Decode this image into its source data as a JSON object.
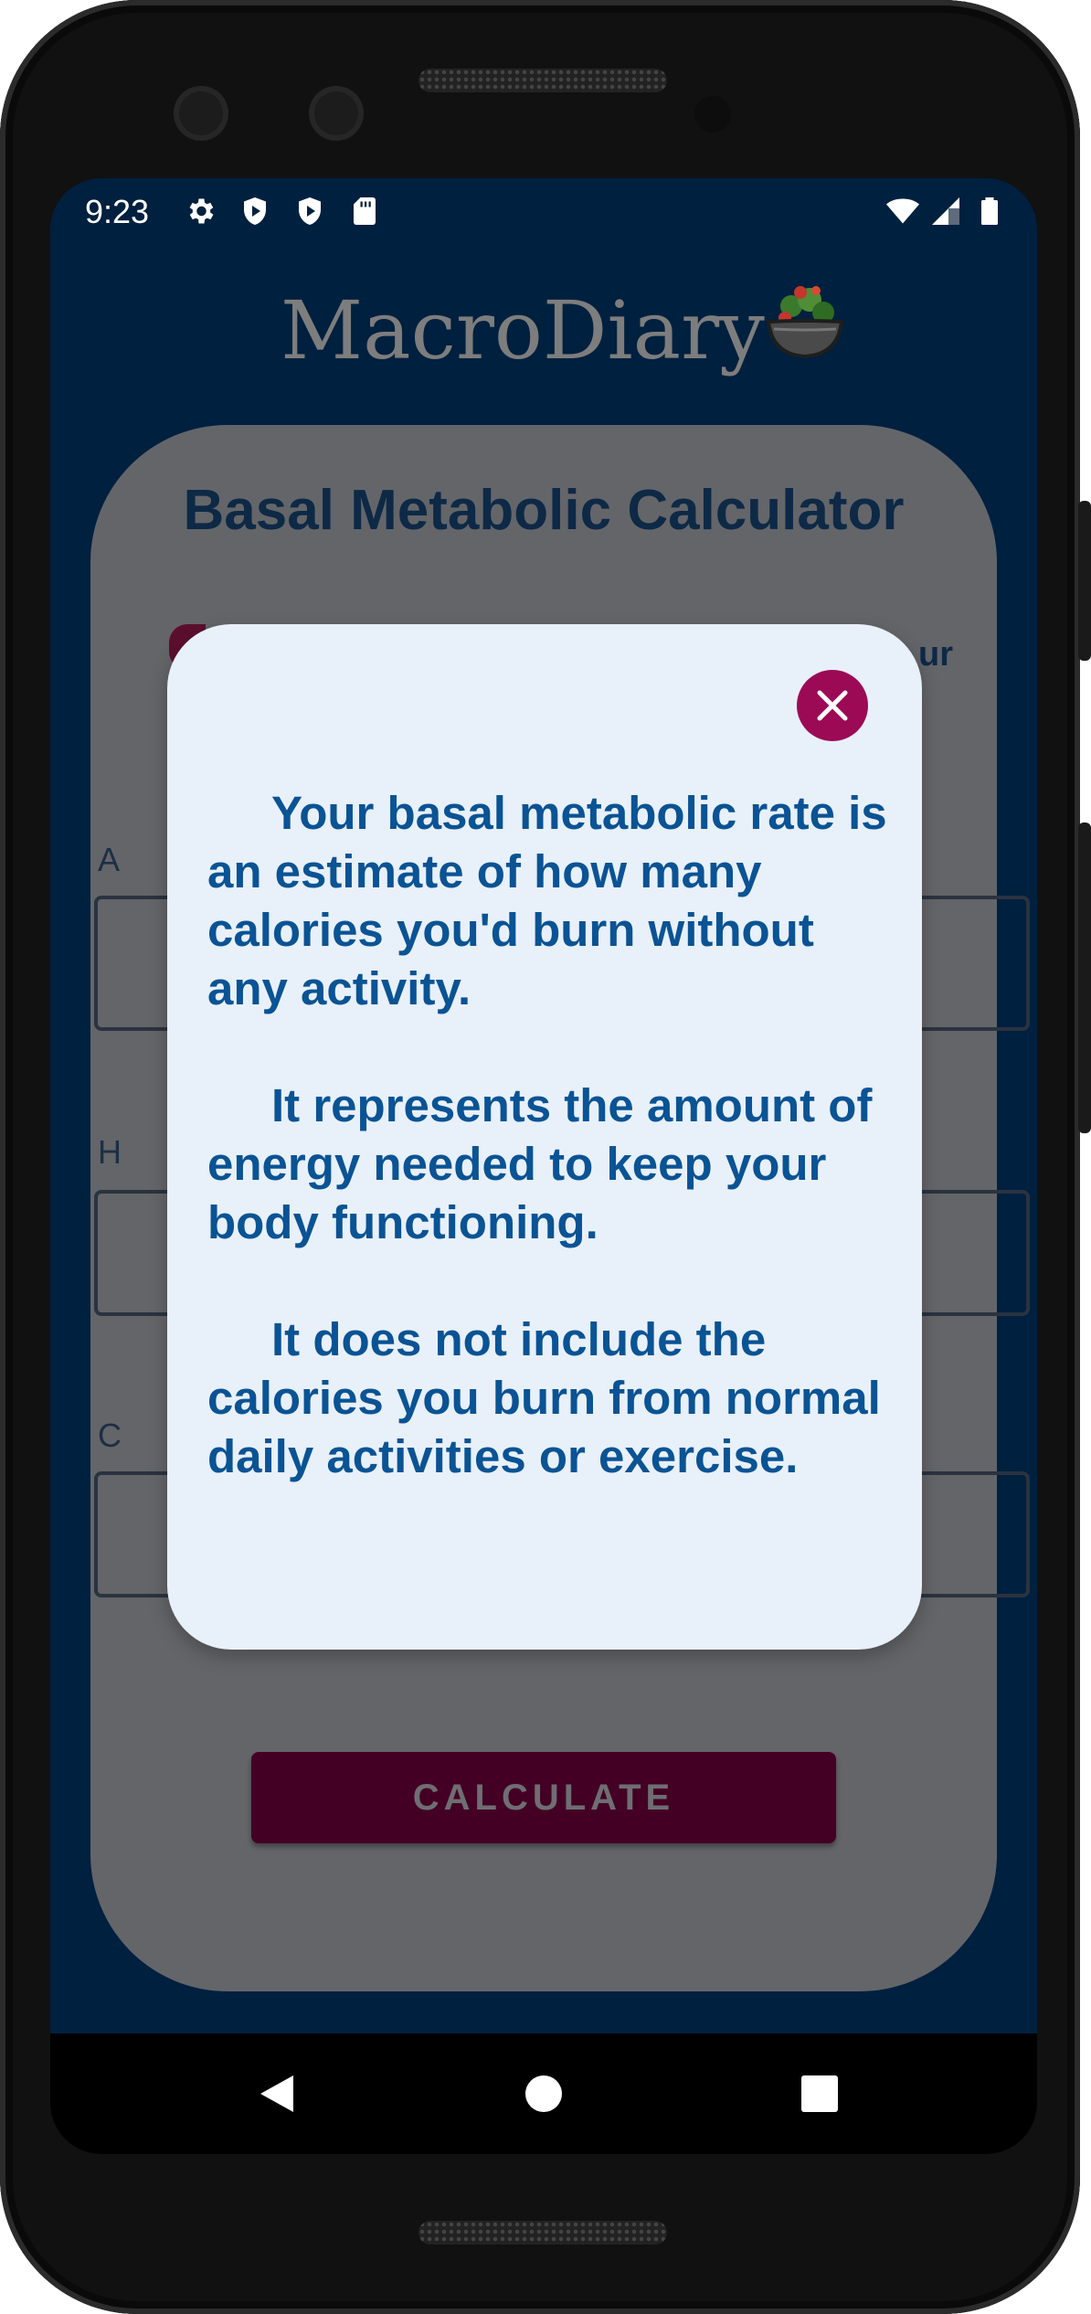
{
  "status_bar": {
    "time": "9:23",
    "left_icons": [
      "gear-icon",
      "play-shield-icon",
      "play-shield-icon",
      "sd-card-icon"
    ],
    "right_icons": [
      "wifi-icon",
      "signal-icon",
      "battery-icon"
    ]
  },
  "app": {
    "logo_text": "MacroDiary",
    "logo_icon": "salad-bowl-icon"
  },
  "calculator": {
    "title": "Basal Metabolic Calculator",
    "peek_text": "ur",
    "field_label_1": "A",
    "field_label_2": "H",
    "field_label_3": "C",
    "button_label": "CALCULATE"
  },
  "modal": {
    "close_icon": "close-icon",
    "paragraphs": [
      "Your basal metabolic rate is an estimate of how many calories you'd burn without any activity.",
      "It represents the amount of energy needed to keep your body functioning.",
      "It does not include the calories you burn from normal daily activities or exercise."
    ]
  },
  "nav_bar": {
    "back_icon": "back-triangle-icon",
    "home_icon": "home-circle-icon",
    "recents_icon": "recents-square-icon"
  },
  "colors": {
    "screen_background": "#00203f",
    "card_dimmed": "#646569",
    "modal_background": "#e8f0fa",
    "modal_text": "#0a5394",
    "close_button": "#9c0a55",
    "calculate_button": "#440024"
  }
}
